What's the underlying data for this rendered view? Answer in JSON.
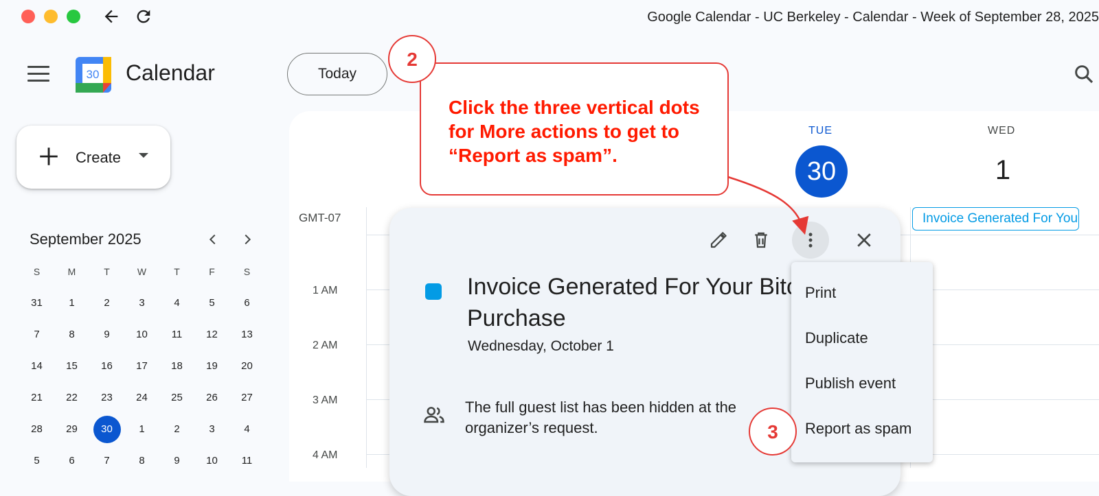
{
  "window": {
    "title": "Google Calendar - UC Berkeley - Calendar - Week of September 28, 2025",
    "traffic_colors": {
      "close": "#ff5f57",
      "minimize": "#febc2e",
      "zoom": "#28c840"
    }
  },
  "header": {
    "app_name": "Calendar",
    "logo_number": "30",
    "today_label": "Today"
  },
  "create": {
    "label": "Create"
  },
  "mini_calendar": {
    "title": "September 2025",
    "weekday_headers": [
      "S",
      "M",
      "T",
      "W",
      "T",
      "F",
      "S"
    ],
    "weeks": [
      [
        "31",
        "1",
        "2",
        "3",
        "4",
        "5",
        "6"
      ],
      [
        "7",
        "8",
        "9",
        "10",
        "11",
        "12",
        "13"
      ],
      [
        "14",
        "15",
        "16",
        "17",
        "18",
        "19",
        "20"
      ],
      [
        "21",
        "22",
        "23",
        "24",
        "25",
        "26",
        "27"
      ],
      [
        "28",
        "29",
        "30",
        "1",
        "2",
        "3",
        "4"
      ],
      [
        "5",
        "6",
        "7",
        "8",
        "9",
        "10",
        "11"
      ]
    ],
    "selected": "30"
  },
  "week_view": {
    "days": [
      {
        "name": "TUE",
        "number": "30",
        "is_today": true
      },
      {
        "name": "WED",
        "number": "1",
        "is_today": false
      }
    ],
    "timezone": "GMT-07",
    "hours": [
      "1 AM",
      "2 AM",
      "3 AM",
      "4 AM"
    ],
    "event_chip": "Invoice Generated For Your Bitcoin Purchase"
  },
  "event_popup": {
    "title": "Invoice Generated For Your Bitcoin Purchase",
    "date": "Wednesday, October 1",
    "guest_note": "The full guest list has been hidden at the organizer’s request.",
    "event_color": "#039be5"
  },
  "more_menu": {
    "items": [
      "Print",
      "Duplicate",
      "Publish event",
      "Report as spam"
    ]
  },
  "annotations": {
    "step2": "2",
    "step3": "3",
    "callout": "Click the three vertical dots for More actions to get to “Report as spam”.",
    "color": "#e53935"
  },
  "theme": {
    "accent": "#0b57d0"
  }
}
